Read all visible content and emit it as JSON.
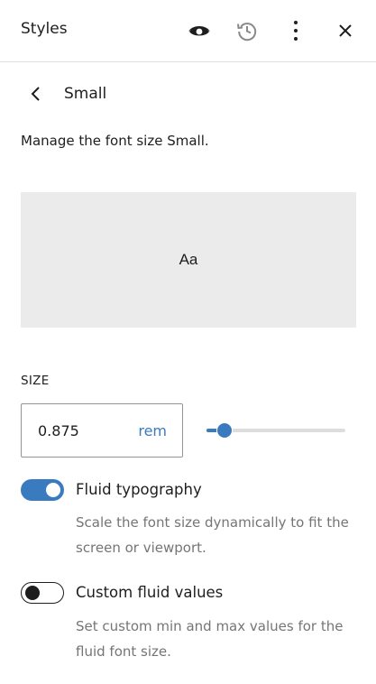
{
  "header": {
    "title": "Styles",
    "icons": [
      "eye-icon",
      "history-icon",
      "more-vertical-icon",
      "close-icon"
    ]
  },
  "nav": {
    "title": "Small"
  },
  "description": "Manage the font size Small.",
  "preview": {
    "text": "Aa",
    "background": "#ebebeb"
  },
  "size": {
    "label": "SIZE",
    "value": "0.875",
    "unit": "rem",
    "slider_fraction": 0.08
  },
  "options": {
    "fluid": {
      "label": "Fluid typography",
      "help": "Scale the font size dynamically to fit the screen or viewport.",
      "enabled": true
    },
    "custom": {
      "label": "Custom fluid values",
      "help": "Set custom min and max values for the fluid font size.",
      "enabled": false
    }
  },
  "colors": {
    "accent": "#3a7bbf",
    "muted_text": "#757575"
  }
}
